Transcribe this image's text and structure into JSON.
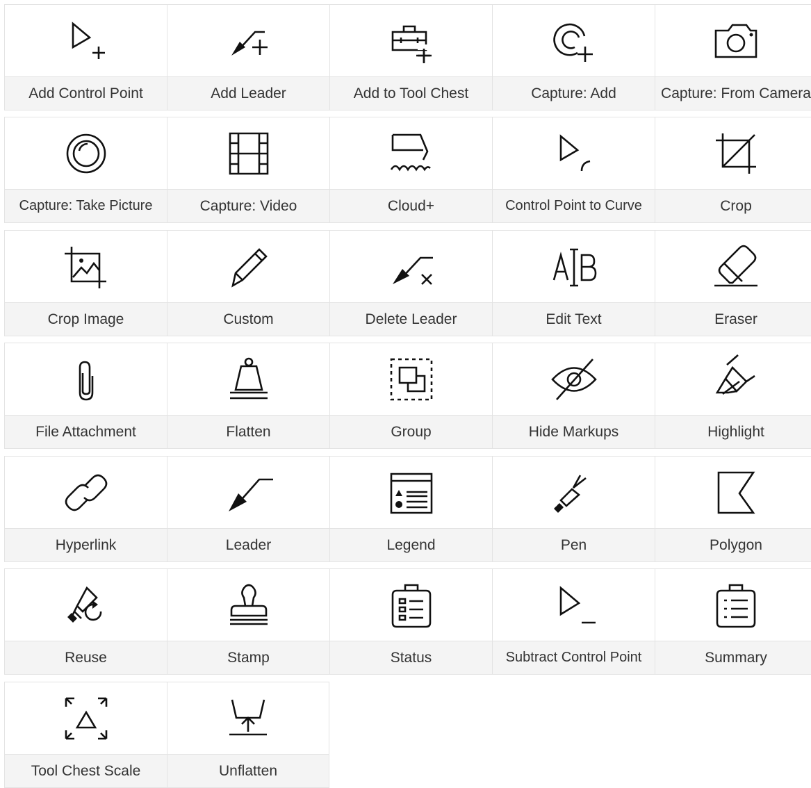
{
  "tools": [
    {
      "label": "Add Control Point",
      "icon": "add-control-point-icon"
    },
    {
      "label": "Add Leader",
      "icon": "add-leader-icon"
    },
    {
      "label": "Add to Tool Chest",
      "icon": "add-to-tool-chest-icon"
    },
    {
      "label": "Capture: Add",
      "icon": "capture-add-icon"
    },
    {
      "label": "Capture: From Camera",
      "icon": "camera-icon"
    },
    {
      "label": "Capture: Take Picture",
      "icon": "take-picture-icon"
    },
    {
      "label": "Capture: Video",
      "icon": "video-film-icon"
    },
    {
      "label": "Cloud+",
      "icon": "cloud-plus-icon"
    },
    {
      "label": "Control Point to Curve",
      "icon": "control-point-to-curve-icon"
    },
    {
      "label": "Crop",
      "icon": "crop-icon"
    },
    {
      "label": "Crop Image",
      "icon": "crop-image-icon"
    },
    {
      "label": "Custom",
      "icon": "pencil-icon"
    },
    {
      "label": "Delete Leader",
      "icon": "delete-leader-icon"
    },
    {
      "label": "Edit Text",
      "icon": "edit-text-icon"
    },
    {
      "label": "Eraser",
      "icon": "eraser-icon"
    },
    {
      "label": "File Attachment",
      "icon": "paperclip-icon"
    },
    {
      "label": "Flatten",
      "icon": "flatten-weight-icon"
    },
    {
      "label": "Group",
      "icon": "group-icon"
    },
    {
      "label": "Hide Markups",
      "icon": "eye-slash-icon"
    },
    {
      "label": "Highlight",
      "icon": "highlighter-icon"
    },
    {
      "label": "Hyperlink",
      "icon": "link-icon"
    },
    {
      "label": "Leader",
      "icon": "leader-arrow-icon"
    },
    {
      "label": "Legend",
      "icon": "legend-icon"
    },
    {
      "label": "Pen",
      "icon": "pen-icon"
    },
    {
      "label": "Polygon",
      "icon": "polygon-icon"
    },
    {
      "label": "Reuse",
      "icon": "reuse-icon"
    },
    {
      "label": "Stamp",
      "icon": "stamp-icon"
    },
    {
      "label": "Status",
      "icon": "status-clipboard-icon"
    },
    {
      "label": "Subtract Control Point",
      "icon": "subtract-control-point-icon"
    },
    {
      "label": "Summary",
      "icon": "summary-clipboard-icon"
    },
    {
      "label": "Tool Chest Scale",
      "icon": "tool-chest-scale-icon"
    },
    {
      "label": "Unflatten",
      "icon": "unflatten-icon"
    }
  ]
}
